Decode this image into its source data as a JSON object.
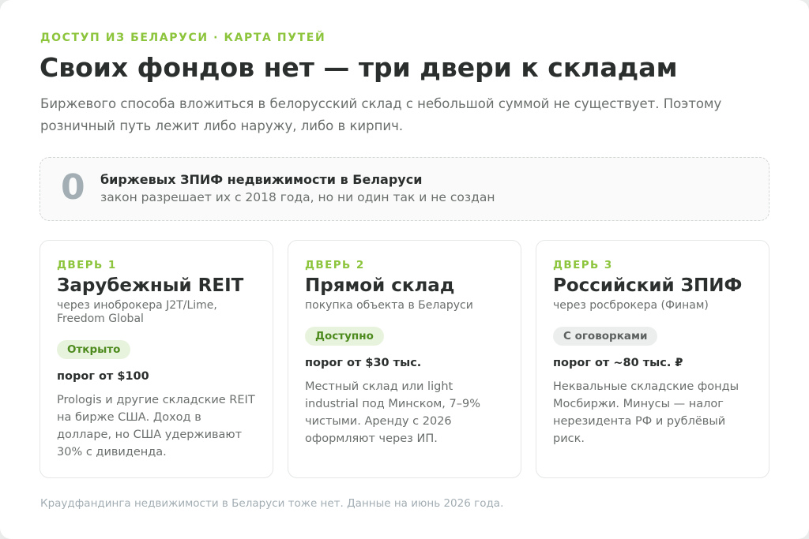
{
  "header": {
    "eyebrow": "ДОСТУП ИЗ БЕЛАРУСИ · КАРТА ПУТЕЙ",
    "title": "Своих фондов нет — три двери к складам",
    "lead": "Биржевого способа вложиться в белорусский склад с небольшой суммой не существует. Поэтому розничный путь лежит либо наружу, либо в кирпич."
  },
  "stat": {
    "number": "0",
    "title": "биржевых ЗПИФ недвижимости в Беларуси",
    "subtitle": "закон разрешает их с 2018 года, но ни один так и не создан"
  },
  "cards": [
    {
      "door": "ДВЕРЬ 1",
      "title": "Зарубежный REIT",
      "via": "через иноброкера J2T/Lime, Freedom Global",
      "badge": "Открыто",
      "badge_color": "#e8f3dd",
      "threshold": "порог от $100",
      "description": "Prologis и другие складские REIT на бирже США. Доход в долларе, но США удерживают 30% с дивиденда."
    },
    {
      "door": "ДВЕРЬ 2",
      "title": "Прямой склад",
      "via": "покупка объекта в Беларуси",
      "badge": "Доступно",
      "badge_color": "#e8f3dd",
      "threshold": "порог от $30 тыс.",
      "description": "Местный склад или light industrial под Минском, 7–9% чистыми. Аренду с 2026 оформляют через ИП."
    },
    {
      "door": "ДВЕРЬ 3",
      "title": "Российский ЗПИФ",
      "via": "через росброкера (Финам)",
      "badge": "С оговорками",
      "badge_color": "#eceeed",
      "threshold": "порог от ~80 тыс. ₽",
      "description": "Неквальные складские фонды Мосбиржи. Минусы — налог нерезидента РФ и рублёвый риск."
    }
  ],
  "footnote": "Краудфандинга недвижимости в Беларуси тоже нет. Данные на июнь 2026 года.",
  "colors": {
    "accent": "#8cc43c",
    "badge_green_text": "#4d8b1f",
    "muted": "#a3aeb4"
  }
}
